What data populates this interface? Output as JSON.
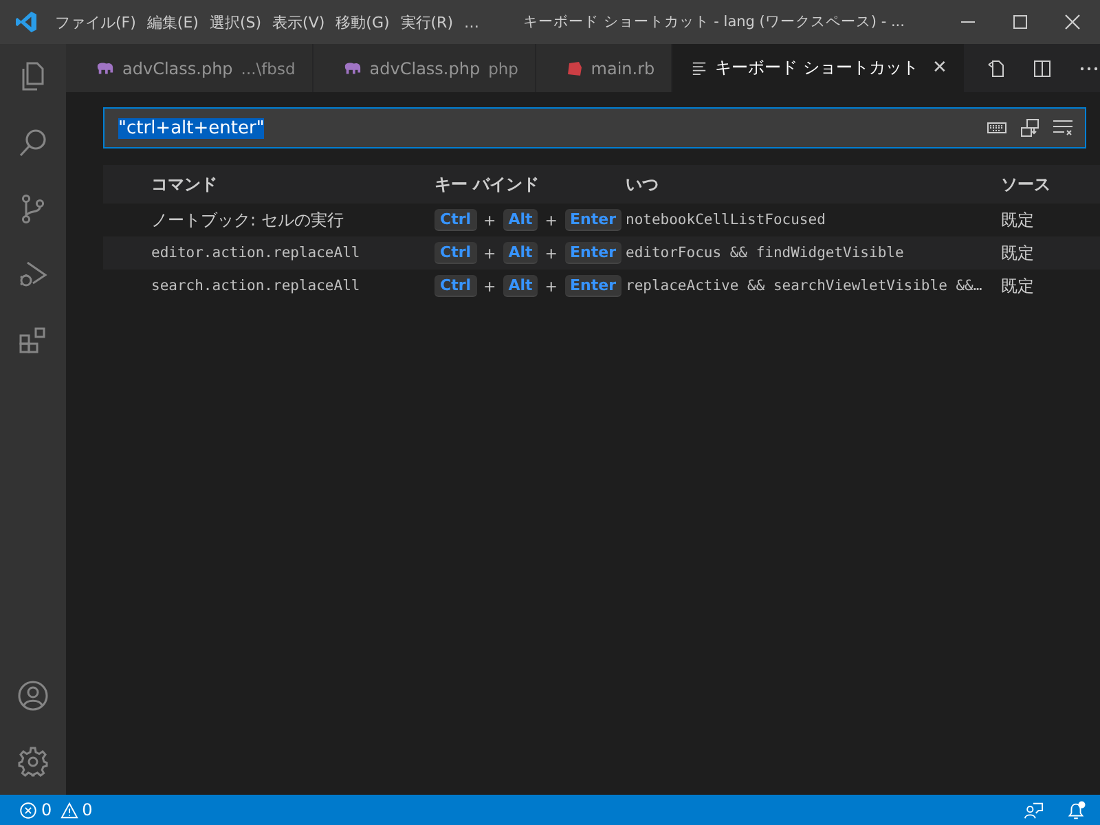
{
  "menu": [
    "ファイル(F)",
    "編集(E)",
    "選択(S)",
    "表示(V)",
    "移動(G)",
    "実行(R)",
    "…"
  ],
  "window": {
    "title": "キーボード ショートカット - lang (ワークスペース) - ..."
  },
  "activity_bar": {
    "top": [
      {
        "kind": "explorer",
        "selected": false
      },
      {
        "kind": "search",
        "selected": false
      },
      {
        "kind": "scm",
        "selected": false
      },
      {
        "kind": "debug",
        "selected": false
      },
      {
        "kind": "extensions",
        "selected": false
      }
    ],
    "bottom": [
      {
        "kind": "account"
      },
      {
        "kind": "settings"
      }
    ]
  },
  "tabs": [
    {
      "kind": "php",
      "label": "advClass.php",
      "description": "...\\fbsd",
      "selected": false
    },
    {
      "kind": "php",
      "label": "advClass.php",
      "description": "php",
      "selected": false
    },
    {
      "kind": "ruby",
      "label": "main.rb",
      "selected": false
    },
    {
      "kind": "keyboard",
      "label": "キーボード ショートカット",
      "selected": true,
      "close": "✕"
    }
  ],
  "search": {
    "value": "\"ctrl+alt+enter\"",
    "selected": true
  },
  "table": {
    "columns": [
      "コマンド",
      "キー バインド",
      "いつ",
      "ソース"
    ],
    "rows": [
      {
        "command": "ノートブック: セルの実行",
        "kind": "title",
        "keys": [
          {
            "kind": "key",
            "label": "Ctrl"
          },
          {
            "kind": "sep",
            "label": "+"
          },
          {
            "kind": "key",
            "label": "Alt"
          },
          {
            "kind": "sep",
            "label": "+"
          },
          {
            "kind": "key",
            "label": "Enter"
          }
        ],
        "when": "notebookCellListFocused",
        "source": "既定"
      },
      {
        "command": "editor.action.replaceAll",
        "kind": "id",
        "keys": [
          {
            "kind": "key",
            "label": "Ctrl"
          },
          {
            "kind": "sep",
            "label": "+"
          },
          {
            "kind": "key",
            "label": "Alt"
          },
          {
            "kind": "sep",
            "label": "+"
          },
          {
            "kind": "key",
            "label": "Enter"
          }
        ],
        "when": "editorFocus && findWidgetVisible",
        "source": "既定"
      },
      {
        "command": "search.action.replaceAll",
        "kind": "id",
        "keys": [
          {
            "kind": "key",
            "label": "Ctrl"
          },
          {
            "kind": "sep",
            "label": "+"
          },
          {
            "kind": "key",
            "label": "Alt"
          },
          {
            "kind": "sep",
            "label": "+"
          },
          {
            "kind": "key",
            "label": "Enter"
          }
        ],
        "when": "replaceActive && searchViewletVisible &&…",
        "source": "既定"
      }
    ]
  },
  "status_bar": {
    "errors": "0",
    "warnings": "0"
  }
}
